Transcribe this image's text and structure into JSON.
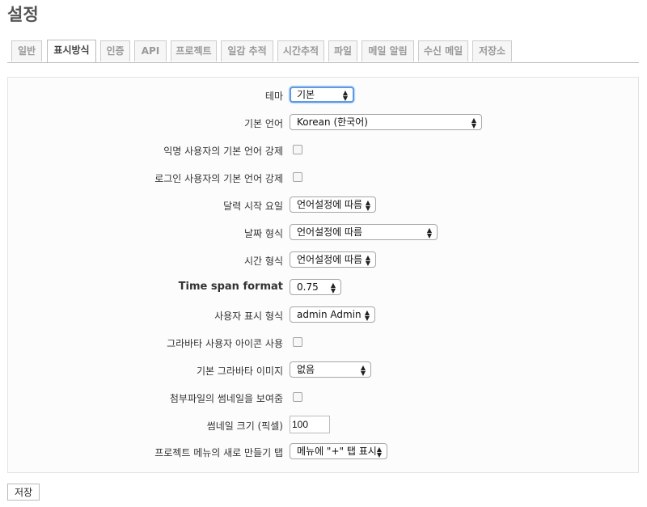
{
  "page": {
    "title": "설정"
  },
  "tabs": [
    {
      "label": "일반",
      "selected": false
    },
    {
      "label": "표시방식",
      "selected": true
    },
    {
      "label": "인증",
      "selected": false
    },
    {
      "label": "API",
      "selected": false
    },
    {
      "label": "프로젝트",
      "selected": false
    },
    {
      "label": "일감 추적",
      "selected": false
    },
    {
      "label": "시간추적",
      "selected": false
    },
    {
      "label": "파일",
      "selected": false
    },
    {
      "label": "메일 알림",
      "selected": false
    },
    {
      "label": "수신 메일",
      "selected": false
    },
    {
      "label": "저장소",
      "selected": false
    }
  ],
  "form": {
    "theme": {
      "label": "테마",
      "value": "기본"
    },
    "default_language": {
      "label": "기본 언어",
      "value": "Korean (한국어)"
    },
    "force_lang_anonymous": {
      "label": "익명 사용자의 기본 언어 강제",
      "checked": false
    },
    "force_lang_logged": {
      "label": "로그인 사용자의 기본 언어 강제",
      "checked": false
    },
    "week_start": {
      "label": "달력 시작 요일",
      "value": "언어설정에 따름"
    },
    "date_format": {
      "label": "날짜 형식",
      "value": "언어설정에 따름"
    },
    "time_format": {
      "label": "시간 형식",
      "value": "언어설정에 따름"
    },
    "timespan_format": {
      "label": "Time span format",
      "value": "0.75"
    },
    "user_format": {
      "label": "사용자 표시 형식",
      "value": "admin Admin"
    },
    "gravatar_enabled": {
      "label": "그라바타 사용자 아이콘 사용",
      "checked": false
    },
    "gravatar_default": {
      "label": "기본 그라바타 이미지",
      "value": "없음"
    },
    "thumbnails_enabled": {
      "label": "첨부파일의 썸네일을 보여줌",
      "checked": false
    },
    "thumbnails_size": {
      "label": "썸네일 크기 (픽셀)",
      "value": "100"
    },
    "new_item_menu_tab": {
      "label": "프로젝트 메뉴의 새로 만들기 탭",
      "value": "메뉴에 \"+\" 탭 표시"
    }
  },
  "save_button": {
    "label": "저장"
  }
}
